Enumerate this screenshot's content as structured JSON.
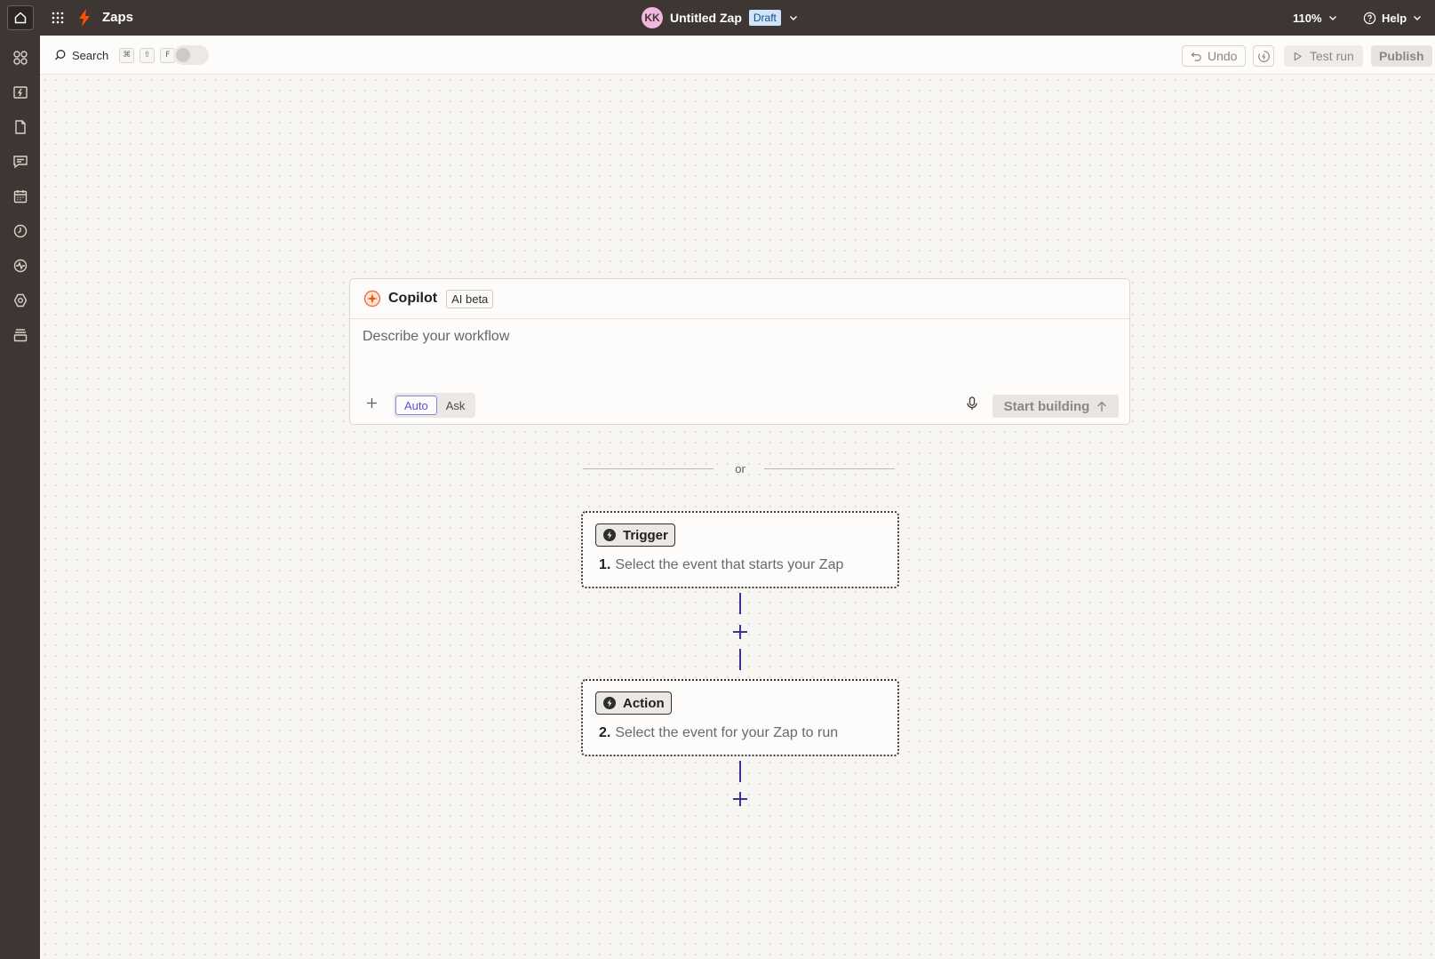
{
  "topbar": {
    "app_title": "Zaps",
    "avatar_initials": "KK",
    "zap_name": "Untitled Zap",
    "status_badge": "Draft",
    "zoom": "110%",
    "help_label": "Help"
  },
  "sidebar": {
    "icons": [
      "apps-icon",
      "zap-inbox-icon",
      "file-icon",
      "chat-icon",
      "calendar-icon",
      "history-icon",
      "activity-icon",
      "settings-icon",
      "layers-icon"
    ]
  },
  "toolbar": {
    "search_label": "Search",
    "shortcut_keys": [
      "⌘",
      "⇧",
      "F"
    ],
    "undo_label": "Undo",
    "test_run_label": "Test run",
    "publish_label": "Publish"
  },
  "copilot": {
    "title": "Copilot",
    "badge": "AI beta",
    "placeholder": "Describe your workflow",
    "modes": [
      "Auto",
      "Ask"
    ],
    "selected_mode": "Auto",
    "start_label": "Start building"
  },
  "divider_text": "or",
  "steps": [
    {
      "type_label": "Trigger",
      "number": "1.",
      "description": "Select the event that starts your Zap"
    },
    {
      "type_label": "Action",
      "number": "2.",
      "description": "Select the event for your Zap to run"
    }
  ],
  "colors": {
    "chrome": "#3d3633",
    "accent_purple": "#5b4fd6",
    "connector": "#3b3397",
    "zap_orange": "#ff4f00",
    "draft_badge": "#cfe3fb"
  }
}
